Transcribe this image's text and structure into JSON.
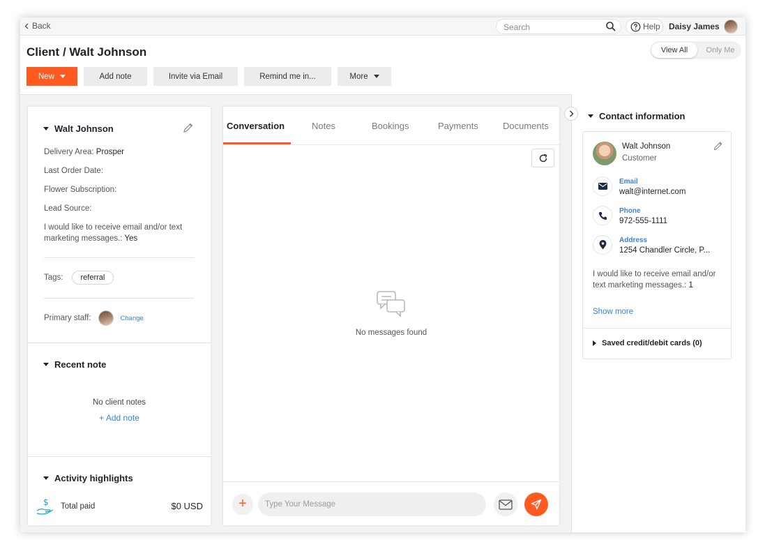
{
  "topbar": {
    "back_label": "Back",
    "search_placeholder": "Search",
    "help_label": "Help",
    "user_name": "Daisy James"
  },
  "header": {
    "title": "Client / Walt Johnson",
    "view_all": "View All",
    "only_me": "Only Me"
  },
  "actions": {
    "new_label": "New",
    "add_note": "Add note",
    "invite": "Invite via Email",
    "remind": "Remind me in...",
    "more": "More"
  },
  "client": {
    "name": "Walt Johnson",
    "fields": [
      {
        "label": "Delivery Area:",
        "value": "Prosper"
      },
      {
        "label": "Last Order Date:",
        "value": ""
      },
      {
        "label": "Flower Subscription:",
        "value": ""
      },
      {
        "label": "Lead Source:",
        "value": ""
      },
      {
        "label": "I would like to receive email and/or text marketing messages.:",
        "value": "Yes"
      }
    ],
    "tags_label": "Tags:",
    "tag": "referral",
    "primary_staff_label": "Primary staff:",
    "change_label": "Change"
  },
  "recent_note": {
    "title": "Recent note",
    "empty": "No client notes",
    "add_label": "Add note"
  },
  "activity": {
    "title": "Activity highlights",
    "total_paid_label": "Total paid",
    "total_paid_value": "$0 USD"
  },
  "tabs": [
    "Conversation",
    "Notes",
    "Bookings",
    "Payments",
    "Documents"
  ],
  "conversation": {
    "empty": "No messages found",
    "input_placeholder": "Type Your Message"
  },
  "contact": {
    "title": "Contact information",
    "name": "Walt Johnson",
    "role": "Customer",
    "email_label": "Email",
    "email": "walt@internet.com",
    "phone_label": "Phone",
    "phone": "972-555-1111",
    "address_label": "Address",
    "address": "1254 Chandler Circle, P...",
    "marketing": "I would like to receive email and/or text marketing messages.:",
    "marketing_value": "1",
    "show_more": "Show more",
    "cards": "Saved credit/debit cards (0)"
  },
  "colors": {
    "accent": "#ff5a1f",
    "link": "#3b82d6"
  }
}
